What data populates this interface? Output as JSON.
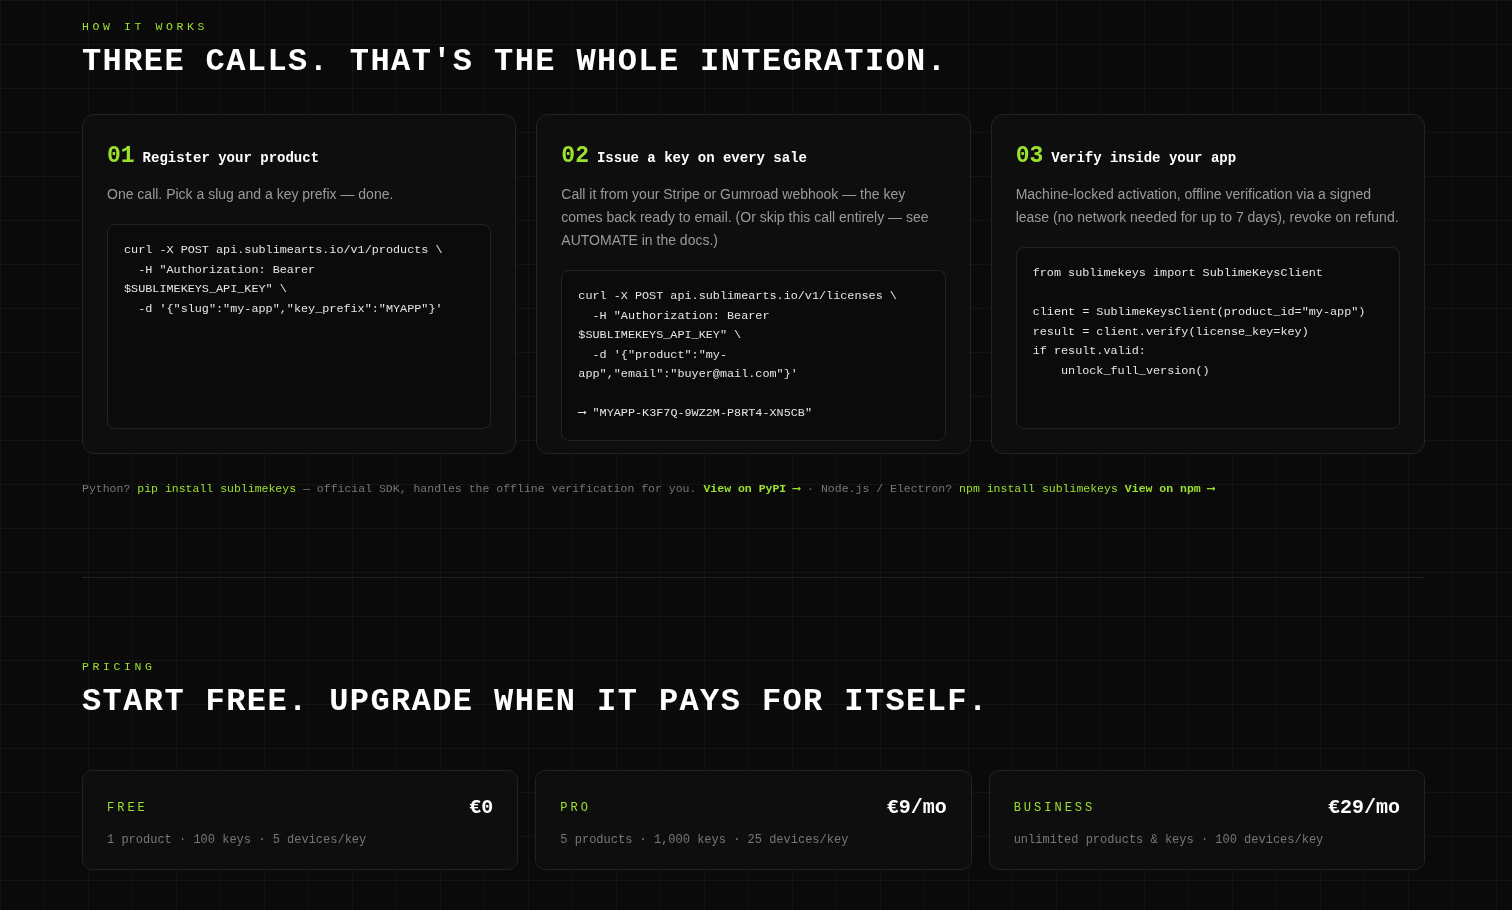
{
  "how_it_works": {
    "eyebrow": "HOW IT WORKS",
    "title": "THREE CALLS. THAT'S THE WHOLE INTEGRATION.",
    "steps": [
      {
        "number": "01",
        "title": "Register your product",
        "description": "One call. Pick a slug and a key prefix — done.",
        "code": [
          [
            "curl -X POST api.sublimearts.io/v1/products \\",
            "  -H \"Authorization: Bearer",
            "$SUBLIMEKEYS_API_KEY\" \\",
            "  -d '{\"slug\":\"my-app\",\"key_prefix\":\"MYAPP\"}'"
          ]
        ]
      },
      {
        "number": "02",
        "title": "Issue a key on every sale",
        "description": "Call it from your Stripe or Gumroad webhook — the key comes back ready to email. (Or skip this call entirely — see AUTOMATE in the docs.)",
        "code": [
          [
            "curl -X POST api.sublimearts.io/v1/licenses \\",
            "  -H \"Authorization: Bearer",
            "$SUBLIMEKEYS_API_KEY\" \\",
            "  -d '{\"product\":\"my-",
            "app\",\"email\":\"buyer@mail.com\"}'"
          ],
          [
            "⟶ \"MYAPP-K3F7Q-9WZ2M-P8RT4-XN5CB\""
          ]
        ]
      },
      {
        "number": "03",
        "title": "Verify inside your app",
        "description": "Machine-locked activation, offline verification via a signed lease (no network needed for up to 7 days), revoke on refund.",
        "code": [
          [
            "from sublimekeys import SublimeKeysClient"
          ],
          [
            "client = SublimeKeysClient(product_id=\"my-app\")",
            "result = client.verify(license_key=key)",
            "if result.valid:",
            "    unlock_full_version()"
          ]
        ]
      }
    ],
    "sdk_note": [
      {
        "kind": "text",
        "text": "Python?"
      },
      {
        "kind": "code",
        "text": "pip install sublimekeys"
      },
      {
        "kind": "text",
        "text": "— official SDK, handles the offline verification for you."
      },
      {
        "kind": "link",
        "text": "View on PyPI ⟶"
      },
      {
        "kind": "text",
        "text": "·"
      },
      {
        "kind": "text",
        "text": "Node.js / Electron?"
      },
      {
        "kind": "code",
        "text": "npm install sublimekeys"
      },
      {
        "kind": "link",
        "text": "View on npm ⟶"
      }
    ]
  },
  "pricing": {
    "eyebrow": "PRICING",
    "title": "START FREE. UPGRADE WHEN IT PAYS FOR ITSELF.",
    "plans": [
      {
        "name": "FREE",
        "price": "€0",
        "features": "1 product · 100 keys · 5 devices/key"
      },
      {
        "name": "PRO",
        "price": "€9/mo",
        "features": "5 products · 1,000 keys · 25 devices/key"
      },
      {
        "name": "BUSINESS",
        "price": "€29/mo",
        "features": "unlimited products & keys · 100 devices/key"
      }
    ]
  }
}
